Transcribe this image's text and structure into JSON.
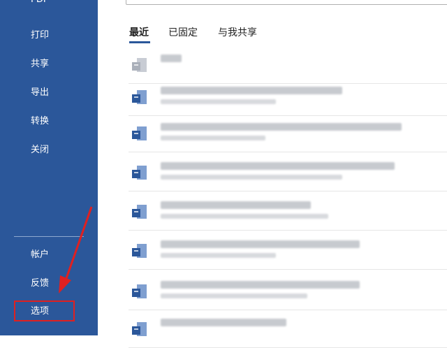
{
  "sidebar": {
    "pdf_label": "PDF",
    "items": [
      "打印",
      "共享",
      "导出",
      "转换",
      "关闭"
    ],
    "bottom_items": [
      "帐户",
      "反馈",
      "选项"
    ]
  },
  "tabs": [
    "最近",
    "已固定",
    "与我共享"
  ],
  "colors": {
    "sidebar": "#2b579a",
    "highlight": "#e02020"
  },
  "icons": [
    "word-doc-icon"
  ],
  "recent_files": [
    {
      "name": "",
      "path": ""
    },
    {
      "name": "",
      "path": ""
    },
    {
      "name": "",
      "path": ""
    },
    {
      "name": "",
      "path": ""
    },
    {
      "name": "",
      "path": ""
    },
    {
      "name": "",
      "path": ""
    },
    {
      "name": "",
      "path": ""
    },
    {
      "name": "",
      "path": ""
    }
  ]
}
